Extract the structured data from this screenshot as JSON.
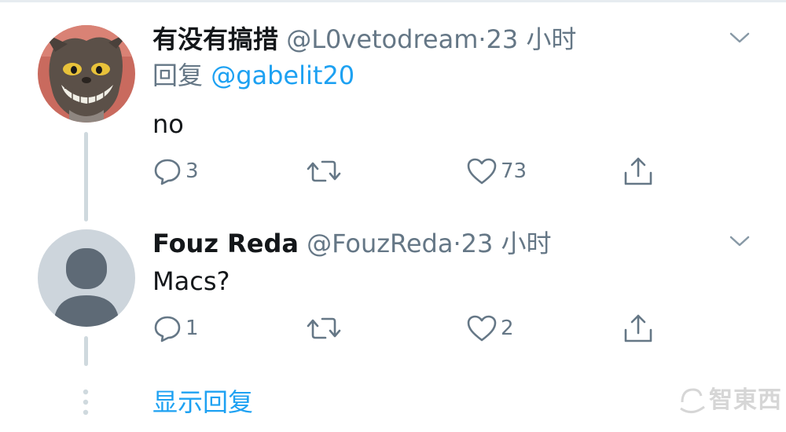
{
  "tweets": [
    {
      "display_name": "有没有搞措",
      "handle": "@L0vetodream",
      "separator": "·",
      "time": "23 小时",
      "reply_prefix": "回复",
      "reply_mention": "@gabelit20",
      "text": "no",
      "replies": "3",
      "retweets": "",
      "likes": "73"
    },
    {
      "display_name": "Fouz Reda",
      "handle": "@FouzReda",
      "separator": "·",
      "time": "23 小时",
      "text": "Macs?",
      "replies": "1",
      "retweets": "",
      "likes": "2"
    }
  ],
  "show_replies_label": "显示回复",
  "watermark_text": "智東西",
  "colors": {
    "link": "#1da1f2",
    "secondary_text": "#657786",
    "primary_text": "#14171a",
    "thread_line": "#cfd9de"
  },
  "icons": {
    "reply": "speech-bubble-icon",
    "retweet": "retweet-arrows-icon",
    "like": "heart-icon",
    "share": "share-upload-icon",
    "more": "chevron-down-icon",
    "more_replies": "vertical-dots-icon"
  }
}
